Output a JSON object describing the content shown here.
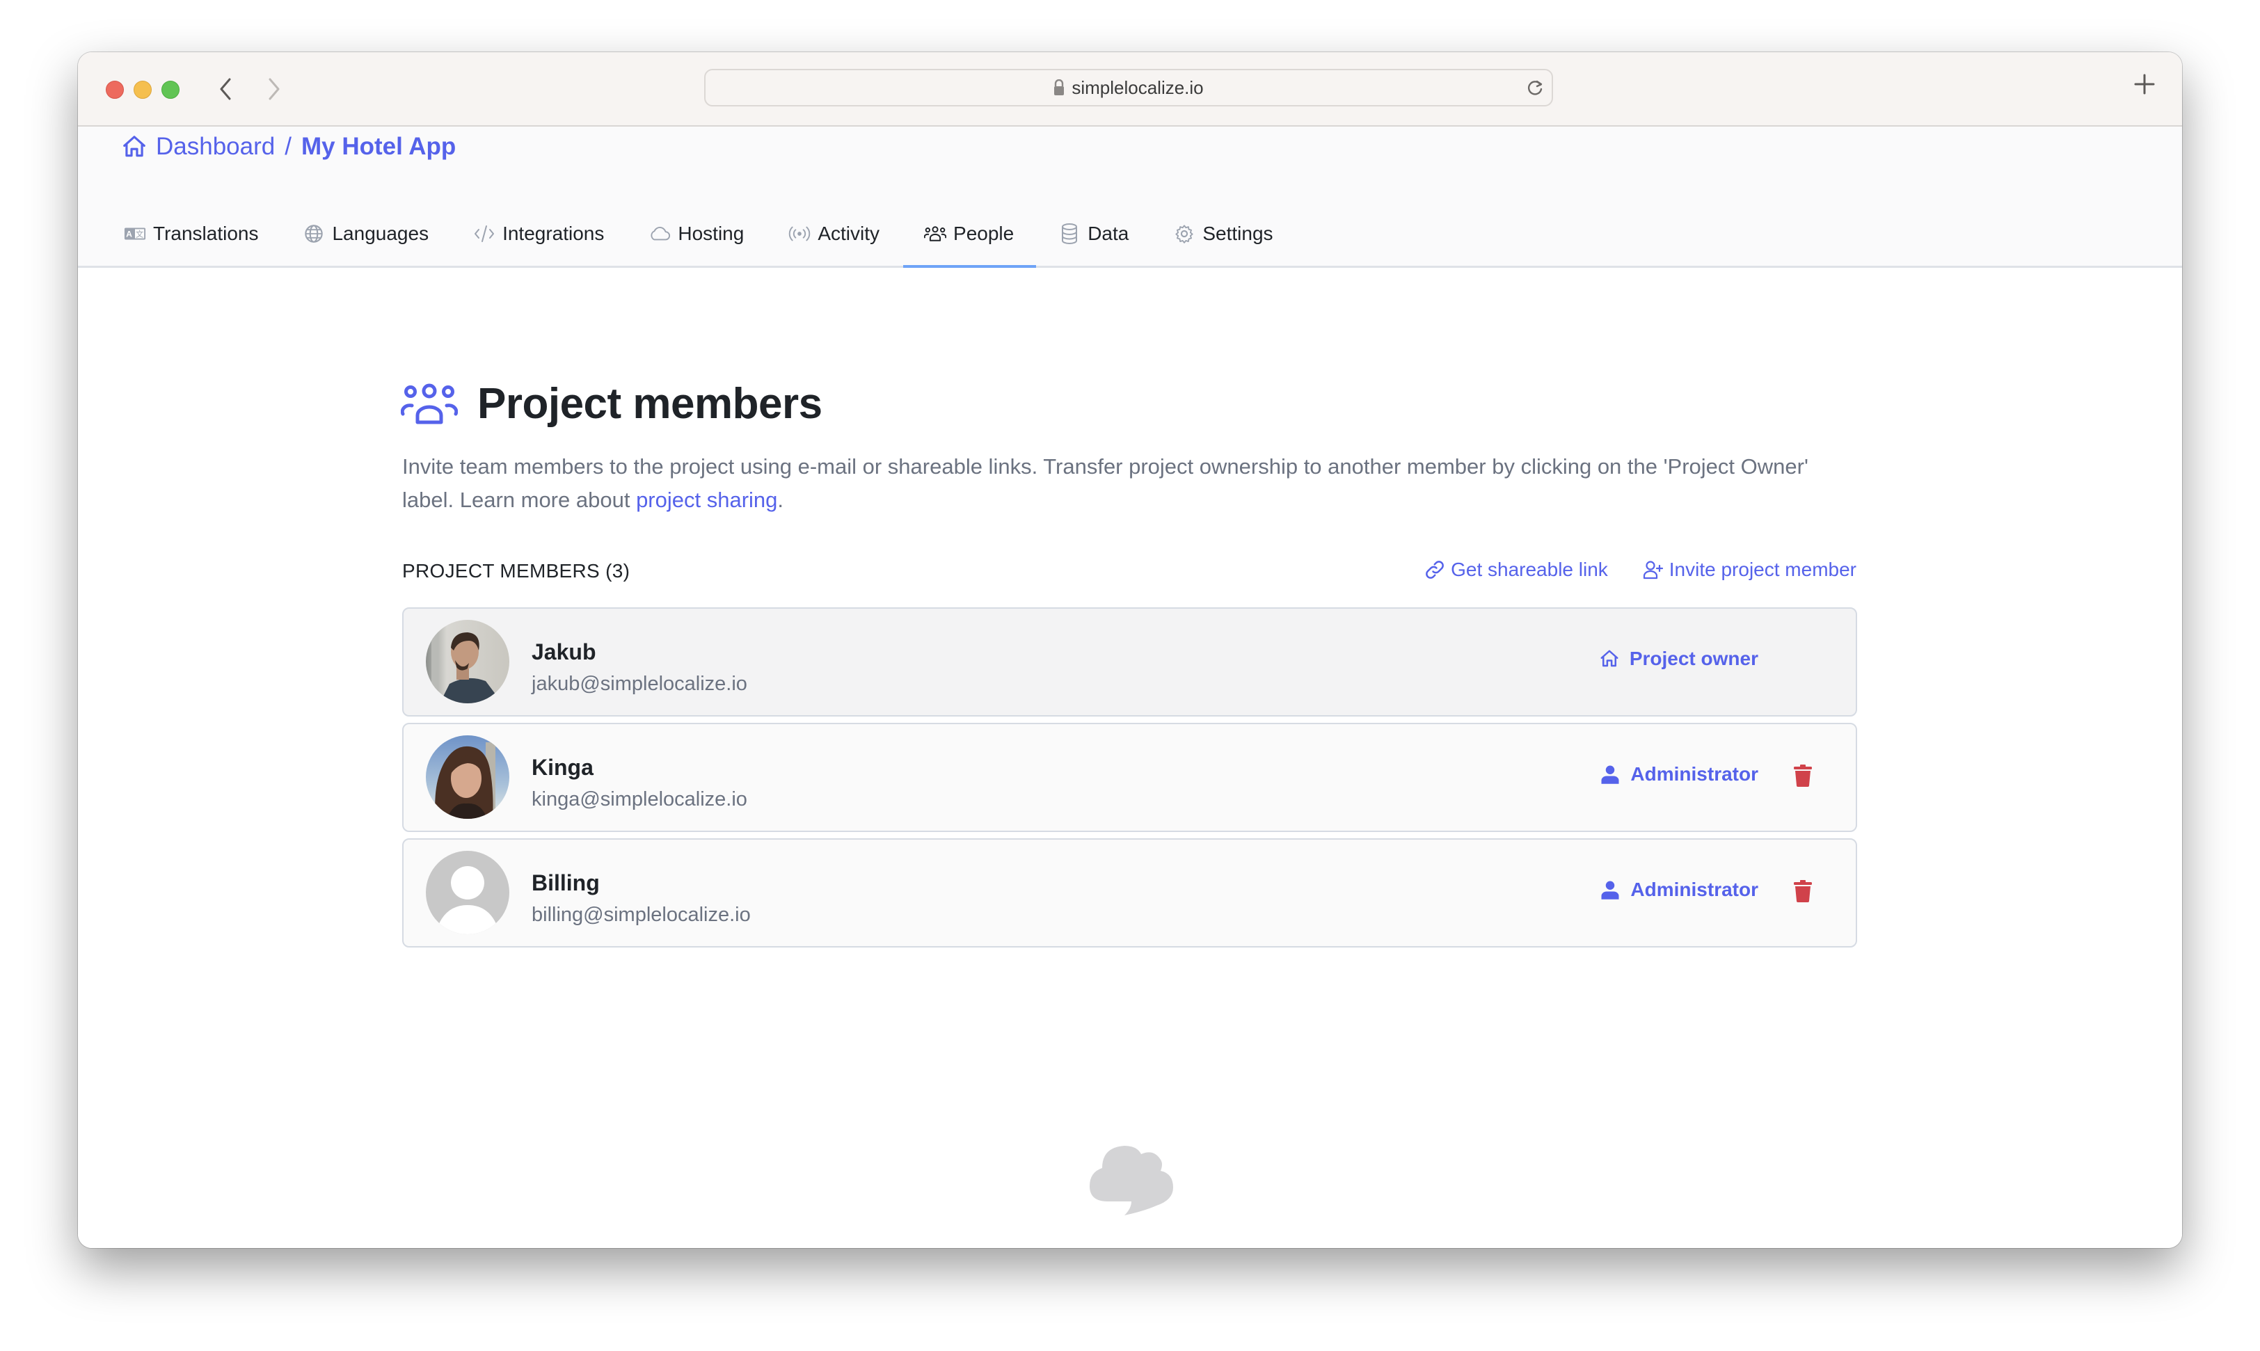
{
  "browser": {
    "url": "simplelocalize.io",
    "colors": {
      "close": "#ed6a5e",
      "minimize": "#f5bf4f",
      "maximize": "#61c454"
    }
  },
  "breadcrumb": {
    "root": "Dashboard",
    "separator": "/",
    "current": "My Hotel App"
  },
  "tabs": [
    {
      "label": "Translations",
      "icon": "translate-icon",
      "active": false
    },
    {
      "label": "Languages",
      "icon": "globe-icon",
      "active": false
    },
    {
      "label": "Integrations",
      "icon": "code-icon",
      "active": false
    },
    {
      "label": "Hosting",
      "icon": "cloud-icon",
      "active": false
    },
    {
      "label": "Activity",
      "icon": "broadcast-icon",
      "active": false
    },
    {
      "label": "People",
      "icon": "people-icon",
      "active": true
    },
    {
      "label": "Data",
      "icon": "database-icon",
      "active": false
    },
    {
      "label": "Settings",
      "icon": "gear-icon",
      "active": false
    }
  ],
  "page": {
    "title": "Project members",
    "description_prefix": "Invite team members to the project using e-mail or shareable links. Transfer project ownership to another member by clicking on the 'Project Owner' label. Learn more about ",
    "description_link": "project sharing",
    "description_suffix": "."
  },
  "members_section": {
    "label": "PROJECT MEMBERS (3)",
    "count": 3,
    "get_link_label": "Get shareable link",
    "invite_label": "Invite project member"
  },
  "members": [
    {
      "name": "Jakub",
      "email": "jakub@simplelocalize.io",
      "role": "Project owner",
      "role_icon": "home-icon",
      "removable": false,
      "avatar": "photo"
    },
    {
      "name": "Kinga",
      "email": "kinga@simplelocalize.io",
      "role": "Administrator",
      "role_icon": "user-icon",
      "removable": true,
      "avatar": "photo"
    },
    {
      "name": "Billing",
      "email": "billing@simplelocalize.io",
      "role": "Administrator",
      "role_icon": "user-icon",
      "removable": true,
      "avatar": "placeholder"
    }
  ],
  "colors": {
    "accent": "#5562ea",
    "tab_underline": "#6ea3f7",
    "danger": "#d0424a",
    "text": "#1f2328",
    "muted": "#6b7280"
  }
}
